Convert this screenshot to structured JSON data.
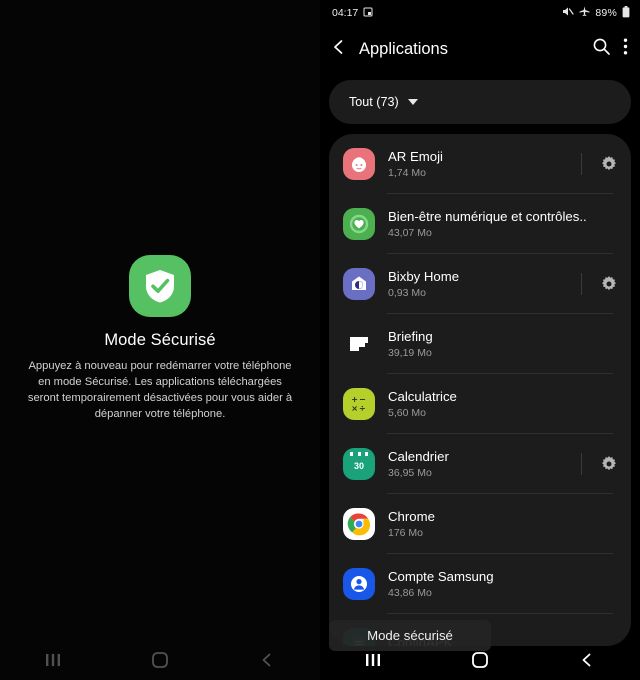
{
  "left_screen": {
    "safe_mode": {
      "icon": "shield-check-icon",
      "title": "Mode Sécurisé",
      "description": "Appuyez à nouveau pour redémarrer votre téléphone en mode Sécurisé. Les applications téléchargées seront temporairement désactivées pour vous aider à dépanner votre téléphone.",
      "icon_color": "#55c163"
    },
    "navbar": {
      "recents": "recents-icon",
      "home": "home-icon",
      "back": "back-icon"
    }
  },
  "right_screen": {
    "statusbar": {
      "time": "04:17",
      "time_icon": "alarm-icon",
      "mute_icon": "sound-off-icon",
      "airplane_icon": "airplane-mode-icon",
      "battery_percent": "89%",
      "battery_icon": "battery-icon"
    },
    "appbar": {
      "back_icon": "back-chevron-icon",
      "title": "Applications",
      "search_icon": "search-icon",
      "more_icon": "more-vertical-icon"
    },
    "filter_chip": {
      "label": "Tout (73)",
      "caret_icon": "chevron-down-icon"
    },
    "apps": [
      {
        "name": "AR Emoji",
        "size": "1,74 Mo",
        "icon": "ar-emoji-icon",
        "icon_color": "#e8737a",
        "has_settings": true
      },
      {
        "name": "Bien-être numérique et contrôles..",
        "size": "43,07 Mo",
        "icon": "digital-wellbeing-icon",
        "icon_color": "#4caf50",
        "has_settings": false
      },
      {
        "name": "Bixby Home",
        "size": "0,93 Mo",
        "icon": "bixby-home-icon",
        "icon_color": "#6b6fc4",
        "has_settings": true
      },
      {
        "name": "Briefing",
        "size": "39,19 Mo",
        "icon": "briefing-icon",
        "icon_color": "#ffffff",
        "has_settings": false
      },
      {
        "name": "Calculatrice",
        "size": "5,60 Mo",
        "icon": "calculator-icon",
        "icon_color": "#b5cf2b",
        "has_settings": false
      },
      {
        "name": "Calendrier",
        "size": "36,95 Mo",
        "icon": "calendar-icon",
        "icon_color": "#1aa37a",
        "has_settings": true
      },
      {
        "name": "Chrome",
        "size": "176 Mo",
        "icon": "chrome-icon",
        "icon_color": "#ffffff",
        "has_settings": false
      },
      {
        "name": "Compte Samsung",
        "size": "43,86 Mo",
        "icon": "samsung-account-icon",
        "icon_color": "#1a56e8",
        "has_settings": false
      },
      {
        "name": "ConfigAPK",
        "size": "",
        "icon": "configapk-icon",
        "icon_color": "#1f8f7a",
        "has_settings": false
      }
    ],
    "toast": {
      "message": "Mode sécurisé"
    },
    "navbar": {
      "recents": "recents-icon",
      "home": "home-icon",
      "back": "back-icon"
    }
  }
}
